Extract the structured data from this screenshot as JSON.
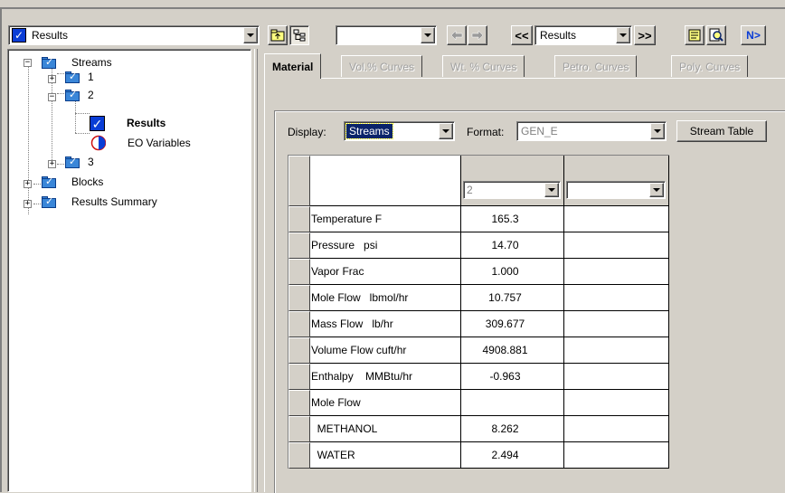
{
  "navigator": {
    "selected": "Results"
  },
  "toolbar": {
    "results_combo": "Results",
    "nav_prev": "<<",
    "nav_next": ">>",
    "next_label": "N>"
  },
  "tree": {
    "streams": "Streams",
    "stream_1": "1",
    "stream_2": "2",
    "results": "Results",
    "eo_variables": "EO Variables",
    "stream_3": "3",
    "blocks": "Blocks",
    "results_summary": "Results Summary"
  },
  "tabs": [
    "Material",
    "Vol.% Curves",
    "Wt. % Curves",
    "Petro. Curves",
    "Poly. Curves"
  ],
  "display": {
    "label": "Display:",
    "value": "Streams"
  },
  "format": {
    "label": "Format:",
    "value": "GEN_E"
  },
  "stream_table_button": "Stream Table",
  "table": {
    "col_stream": "2",
    "col_stream2": "",
    "rows": [
      {
        "label": "Temperature F",
        "value": "165.3"
      },
      {
        "label": "Pressure   psi",
        "value": "14.70"
      },
      {
        "label": "Vapor Frac",
        "value": "1.000"
      },
      {
        "label": "Mole Flow   lbmol/hr",
        "value": "10.757"
      },
      {
        "label": "Mass Flow   lb/hr",
        "value": "309.677"
      },
      {
        "label": "Volume Flow cuft/hr",
        "value": "4908.881"
      },
      {
        "label": "Enthalpy    MMBtu/hr",
        "value": "-0.963"
      },
      {
        "label": "Mole Flow",
        "value": ""
      },
      {
        "label": "  METHANOL",
        "value": "8.262"
      },
      {
        "label": "  WATER",
        "value": "2.494"
      }
    ]
  },
  "colors": {
    "check_blue": "#0a3dd6",
    "folder_blue": "#3a86d8",
    "selection": "#0a246a"
  }
}
